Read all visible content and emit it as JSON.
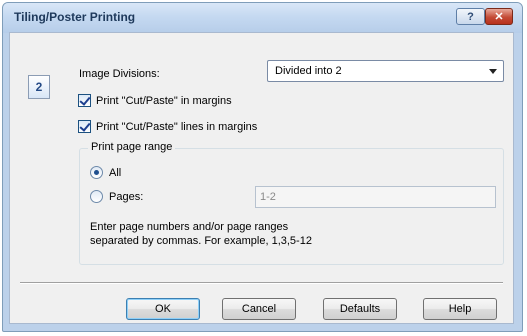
{
  "window": {
    "title": "Tiling/Poster Printing",
    "help_button": "?",
    "close_button": "✕"
  },
  "division_icon": "2",
  "image_divisions": {
    "label": "Image Divisions:",
    "selected": "Divided into 2"
  },
  "options": {
    "cut_paste_in_margins": {
      "label": "Print \"Cut/Paste\" in margins",
      "checked": true
    },
    "cut_paste_lines_in_margins": {
      "label": "Print \"Cut/Paste\" lines in margins",
      "checked": true
    }
  },
  "print_range": {
    "group_label": "Print page range",
    "all_label": "All",
    "pages_label": "Pages:",
    "selected": "All",
    "pages_value": "1-2",
    "hint_line1": "Enter page numbers and/or page ranges",
    "hint_line2": "separated by commas. For example, 1,3,5-12"
  },
  "buttons": {
    "ok": "OK",
    "cancel": "Cancel",
    "defaults": "Defaults",
    "help": "Help"
  }
}
